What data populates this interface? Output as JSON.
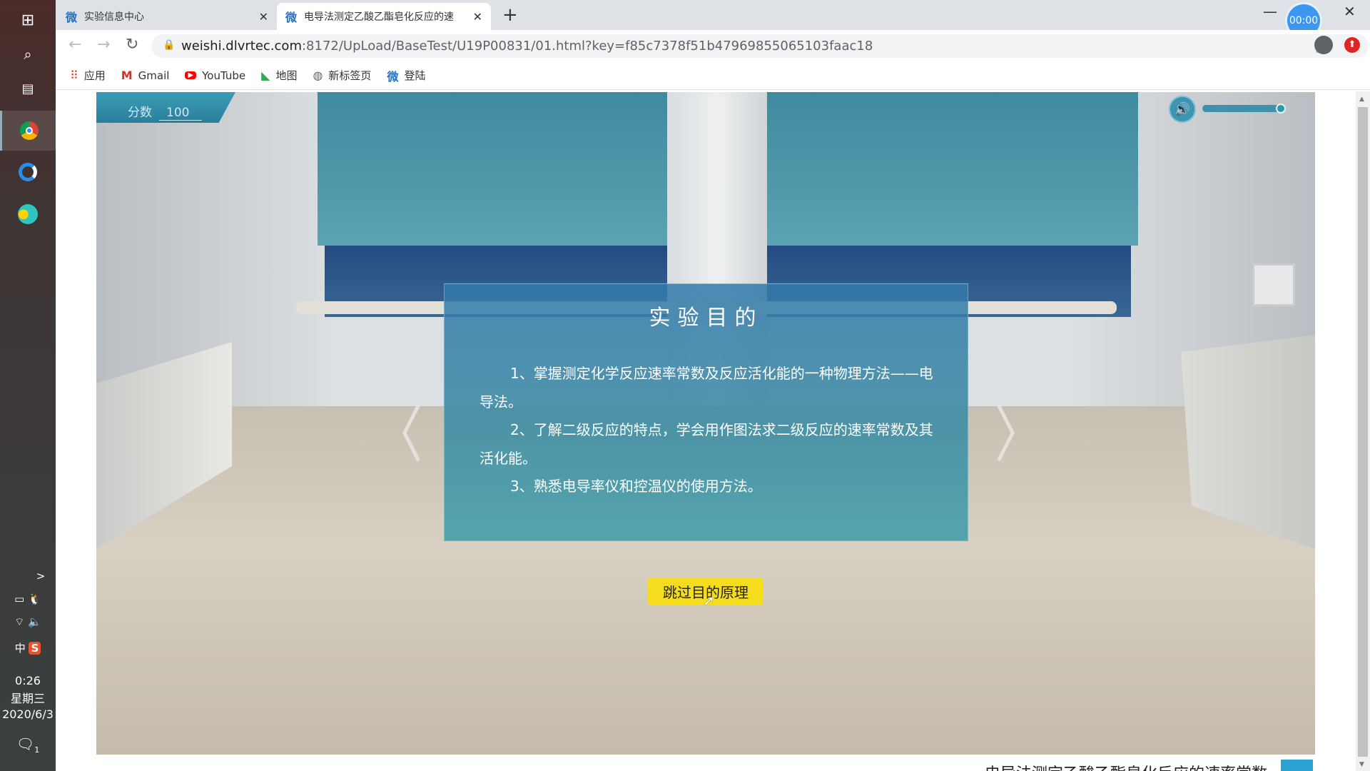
{
  "taskbar": {
    "time": "0:26",
    "weekday": "星期三",
    "date": "2020/6/3",
    "ime": "中",
    "notification_count": "1"
  },
  "browser": {
    "tabs": [
      {
        "label": "实验信息中心",
        "favicon": "微",
        "active": false
      },
      {
        "label": "电导法测定乙酸乙酯皂化反应的速",
        "favicon": "微",
        "active": true
      }
    ],
    "url_host": "weishi.dlvrtec.com",
    "url_rest": ":8172/UpLoad/BaseTest/U19P00831/01.html?key=f85c7378f51b47969855065103faac18",
    "timer": "00:00",
    "bookmarks": [
      {
        "label": "应用",
        "icon": "apps-grid-icon"
      },
      {
        "label": "Gmail",
        "icon": "gmail-icon"
      },
      {
        "label": "YouTube",
        "icon": "youtube-icon"
      },
      {
        "label": "地图",
        "icon": "maps-icon"
      },
      {
        "label": "新标签页",
        "icon": "globe-icon"
      },
      {
        "label": "登陆",
        "icon": "wei-icon"
      }
    ]
  },
  "game": {
    "score_label": "分数",
    "score_value": "100",
    "volume_level": 0.92,
    "dialog": {
      "title": "实验目的",
      "paragraphs": [
        "1、掌握测定化学反应速率常数及反应活化能的一种物理方法——电导法。",
        "2、了解二级反应的特点，学会用作图法求二级反应的速率常数及其活化能。",
        "3、熟悉电导率仪和控温仪的使用方法。"
      ]
    },
    "skip_button": "跳过目的原理"
  },
  "below_text": "电导法测定乙酸乙酯皂化反应的速率常数",
  "colors": {
    "accent": "#3d95b2",
    "skip_button": "#f5dc1c",
    "dialog": "#3a86a8"
  }
}
